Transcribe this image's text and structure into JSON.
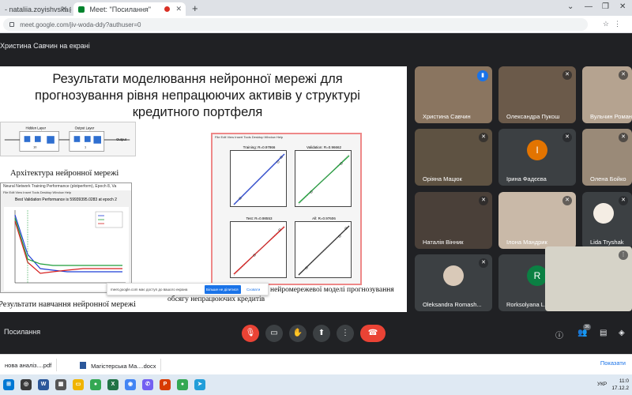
{
  "browser": {
    "tabs": [
      {
        "title": "- nataliia.zoyishvska@eur",
        "active": false
      },
      {
        "title": "Meet: \"Посилання\"",
        "active": true
      }
    ],
    "new_tab": "+",
    "url": "meet.google.com/jiv-woda-ddy?authuser=0"
  },
  "meeting": {
    "presenting_label": "Христина Савчин на екрані",
    "name": "Посилання",
    "participant_count": "36"
  },
  "slide": {
    "title": "Результати моделювання нейронної мережі для прогнозування рівня непрацюючих активів у структурі кредитного портфеля",
    "nn_caption": "Архітектура нейронної мережі",
    "train_window_title": "Neural Network Training Performance (plotperform), Epoch 8, Va",
    "train_menu": "File  Edit  View  Insert  Tools  Desktop  Window  Help",
    "train_heading": "Best Validation Performance is 59939395.0283 at epoch 2",
    "train_xlabel": "8 Epochs",
    "train_caption": "Результати навчання  нейронної мережі",
    "reg_menu": "File  Edit  View  Insert  Tools  Desktop  Window  Help",
    "reg_titles": [
      "Training: R=0.97866",
      "Validation: R=0.96662",
      "Test: R=0.98553",
      "All: R=0.97606"
    ],
    "reg_caption": "Побудова тестування елементів нейромережевої моделі прогнозування обсягу непрацюючих кредитів",
    "share_notice": "meet.google.com має доступ до вашого екрана",
    "share_stop": "Більше не ділитися",
    "share_hide": "Сховати"
  },
  "participants": [
    {
      "name": "Христина Савчин",
      "speaking": true
    },
    {
      "name": "Олександра Пукош",
      "speaking": false
    },
    {
      "name": "Вульчин Роман",
      "speaking": false
    },
    {
      "name": "Оріяна Мацюк",
      "speaking": false
    },
    {
      "name": "Ірина Фадєєва",
      "initial": "І",
      "color": "#e37400"
    },
    {
      "name": "Олена Бойко",
      "speaking": false
    },
    {
      "name": "Наталія Вінник",
      "speaking": false
    },
    {
      "name": "Ілона Мандрик",
      "speaking": false
    },
    {
      "name": "Lida Tryshak",
      "speaking": false
    },
    {
      "name": "Oleksandra Romash...",
      "speaking": false
    },
    {
      "name": "Rorksolyana L...",
      "initial": "R",
      "color": "#0b8043"
    }
  ],
  "downloads": [
    {
      "name": "нова аналіз....pdf"
    },
    {
      "name": "Магістерська Ма....docx"
    }
  ],
  "show_all": "Показати",
  "tray": {
    "lang": "УКР",
    "time": "11:0",
    "date": "17.12.2"
  },
  "colors": {
    "meet_bg": "#202124",
    "end_call": "#ea4335",
    "accent": "#1a73e8"
  }
}
